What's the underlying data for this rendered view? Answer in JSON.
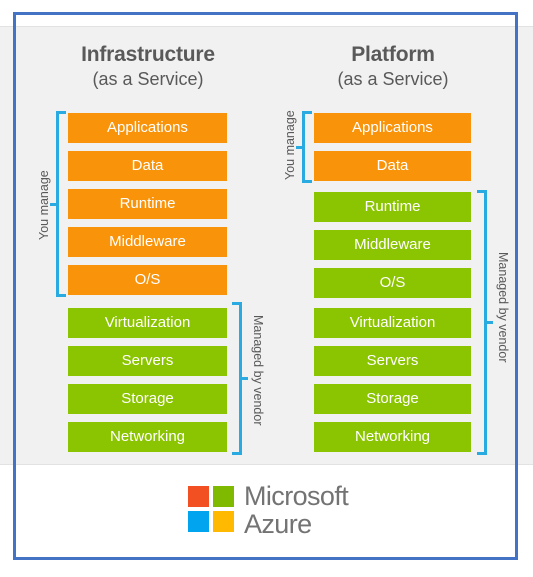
{
  "slide": {
    "frame_color": "#4472c4",
    "band_color": "#f1f1f1"
  },
  "columns": [
    {
      "id": "iaas",
      "title_main": "Infrastructure",
      "title_sub": "(as a Service)",
      "layers": [
        {
          "label": "Applications",
          "owner": "customer",
          "color": "#f9930a"
        },
        {
          "label": "Data",
          "owner": "customer",
          "color": "#f9930a"
        },
        {
          "label": "Runtime",
          "owner": "customer",
          "color": "#f9930a"
        },
        {
          "label": "Middleware",
          "owner": "customer",
          "color": "#f9930a"
        },
        {
          "label": "O/S",
          "owner": "customer",
          "color": "#f9930a"
        },
        {
          "label": "Virtualization",
          "owner": "vendor",
          "color": "#8bc400"
        },
        {
          "label": "Servers",
          "owner": "vendor",
          "color": "#8bc400"
        },
        {
          "label": "Storage",
          "owner": "vendor",
          "color": "#8bc400"
        },
        {
          "label": "Networking",
          "owner": "vendor",
          "color": "#8bc400"
        }
      ],
      "you_manage_label": "You manage",
      "vendor_label": "Managed by vendor"
    },
    {
      "id": "paas",
      "title_main": "Platform",
      "title_sub": "(as a Service)",
      "layers": [
        {
          "label": "Applications",
          "owner": "customer",
          "color": "#f9930a"
        },
        {
          "label": "Data",
          "owner": "customer",
          "color": "#f9930a"
        },
        {
          "label": "Runtime",
          "owner": "vendor",
          "color": "#8bc400"
        },
        {
          "label": "Middleware",
          "owner": "vendor",
          "color": "#8bc400"
        },
        {
          "label": "O/S",
          "owner": "vendor",
          "color": "#8bc400"
        },
        {
          "label": "Virtualization",
          "owner": "vendor",
          "color": "#8bc400"
        },
        {
          "label": "Servers",
          "owner": "vendor",
          "color": "#8bc400"
        },
        {
          "label": "Storage",
          "owner": "vendor",
          "color": "#8bc400"
        },
        {
          "label": "Networking",
          "owner": "vendor",
          "color": "#8bc400"
        }
      ],
      "you_manage_label": "You manage",
      "vendor_label": "Managed by vendor"
    }
  ],
  "logo": {
    "line1": "Microsoft",
    "line2": "Azure",
    "squares": {
      "red": "#f25022",
      "green": "#7fba00",
      "blue": "#00a4ef",
      "yellow": "#ffb900"
    }
  }
}
